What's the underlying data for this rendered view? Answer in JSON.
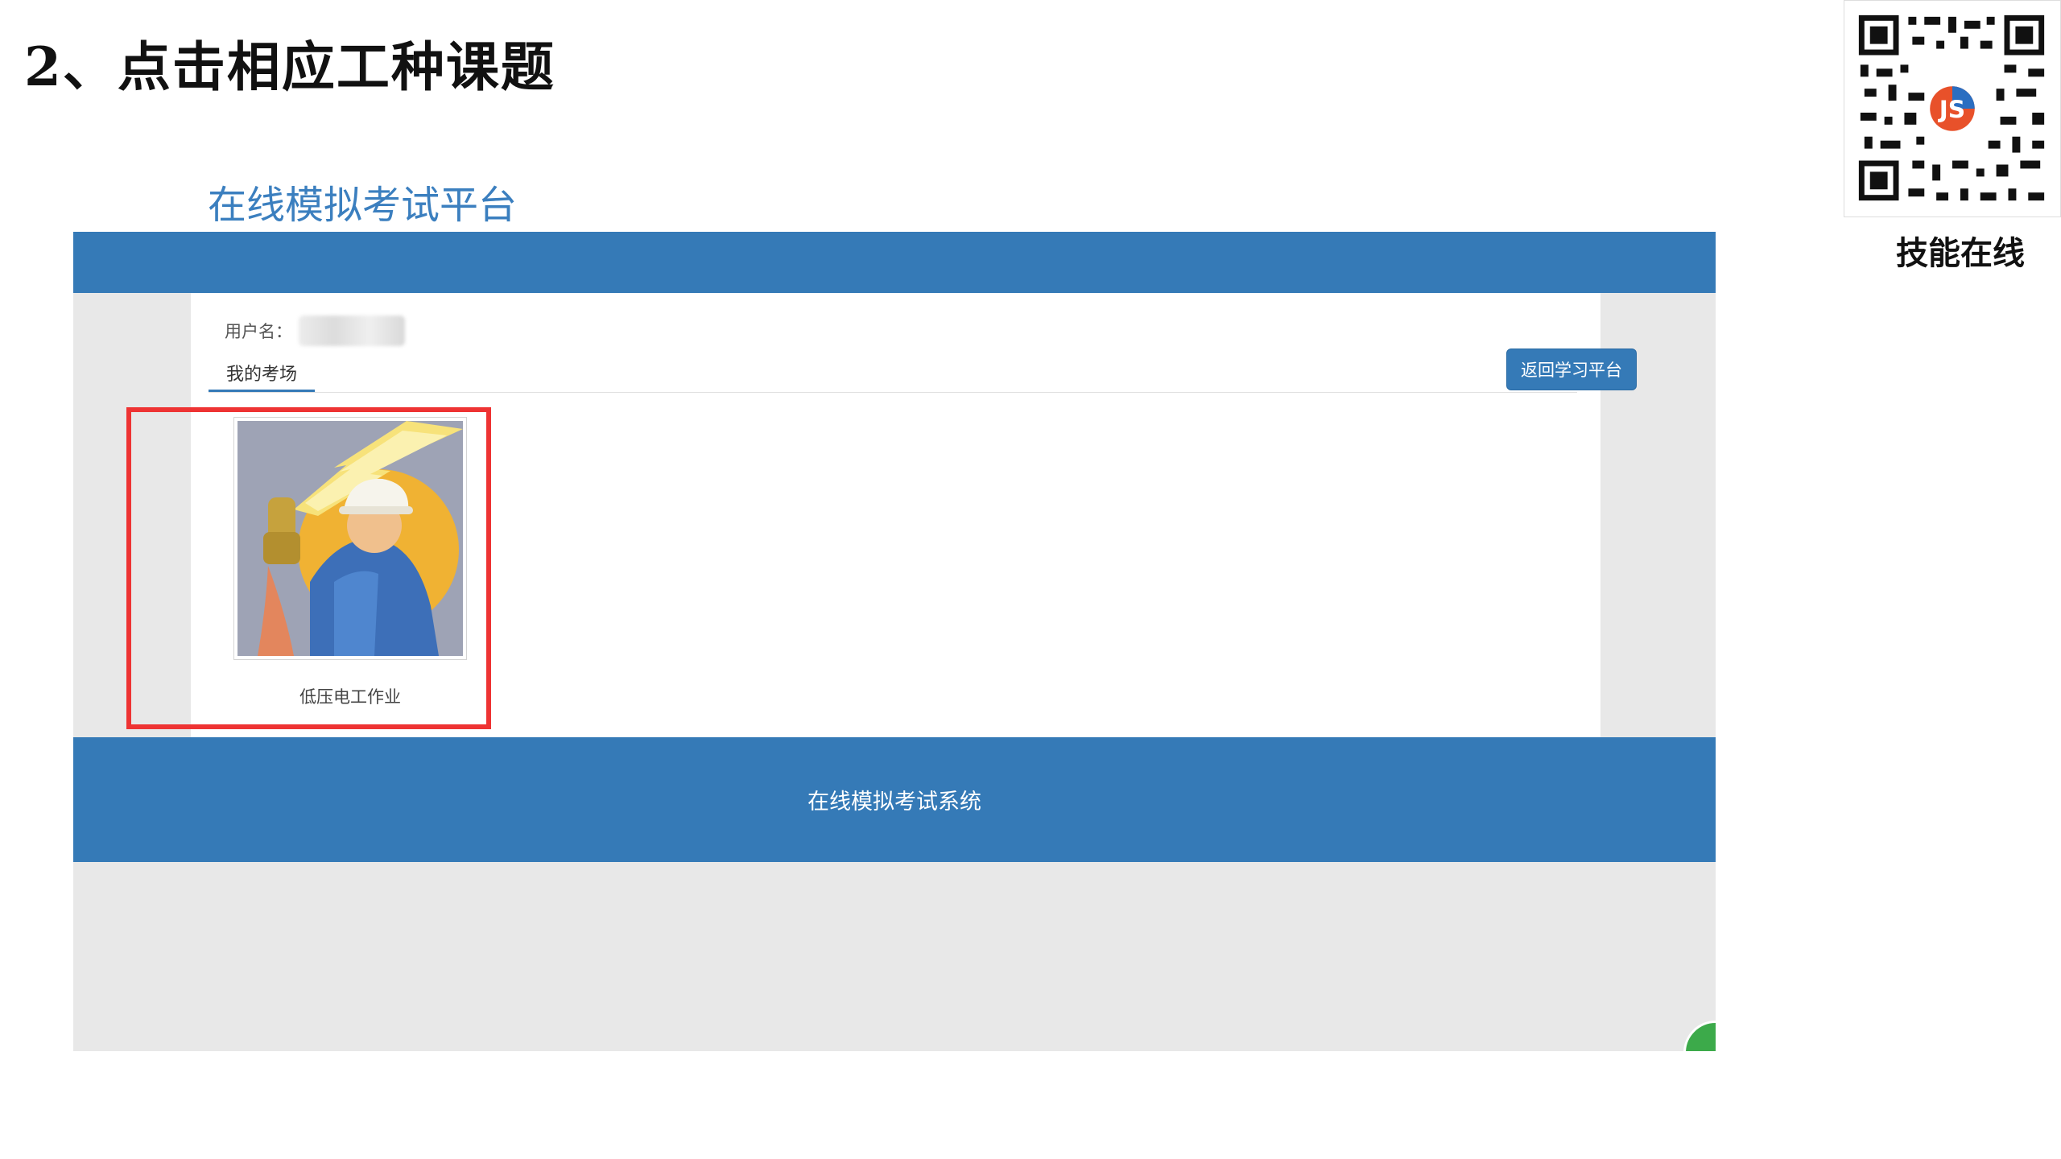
{
  "slide": {
    "title": "2、点击相应工种课题"
  },
  "qr": {
    "caption": "技能在线",
    "logo_letters": "JS",
    "icon": "qr-code-icon"
  },
  "app": {
    "title": "在线模拟考试平台",
    "user_label": "用户名：",
    "tab_label": "我的考场",
    "back_button": "返回学习平台",
    "cards": [
      {
        "label": "低压电工作业",
        "icon": "electrician-illustration"
      }
    ],
    "footer_text": "在线模拟考试系统"
  },
  "colors": {
    "brand_blue": "#357ab7",
    "highlight_red": "#ee3333",
    "page_gray": "#e8e8e8"
  }
}
